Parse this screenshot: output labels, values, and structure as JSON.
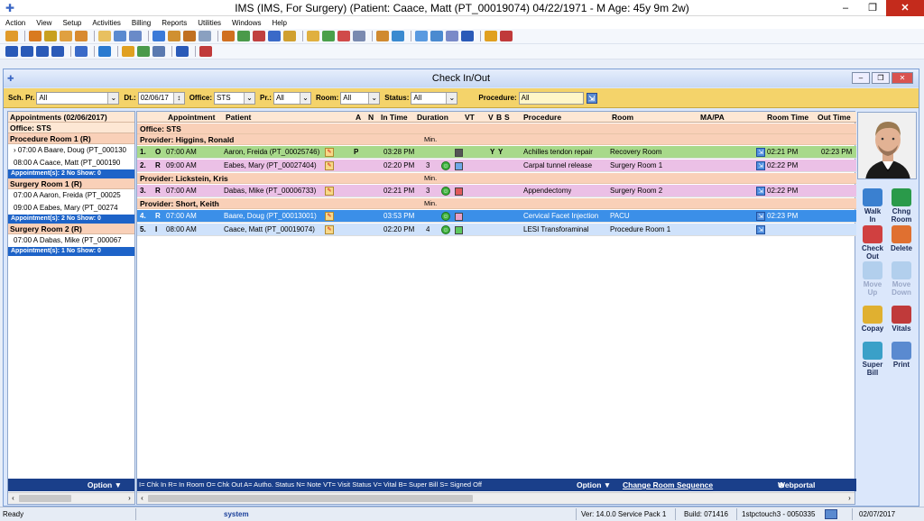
{
  "window": {
    "title": "IMS (IMS, For Surgery)    (Patient: Caace, Matt  (PT_00019074) 04/22/1971 - M Age: 45y 9m 2w)",
    "minimize": "–",
    "restore": "❐",
    "close": "✕"
  },
  "menu": [
    "Action",
    "View",
    "Setup",
    "Activities",
    "Billing",
    "Reports",
    "Utilities",
    "Windows",
    "Help"
  ],
  "toolbar1_colors": [
    "#e09a2a",
    "#d97a20",
    "#c8a020",
    "#e0a040",
    "#d88a30",
    "#e8c060",
    "#5a8ad0",
    "#6a8ac8",
    "#3a7ad8",
    "#d09030",
    "#c07020",
    "#8aa0c0",
    "#d07020",
    "#4a9a4a",
    "#c04040",
    "#3a6ac8",
    "#d0a030",
    "#e0b040",
    "#4aa04a",
    "#d04a4a",
    "#7a8ab0",
    "#d08a30",
    "#3a8ad0",
    "#5a9ae0",
    "#4a8ad0",
    "#7a8ac8",
    "#2a5ab8",
    "#e0a020",
    "#c03a3a"
  ],
  "toolbar2_colors": [
    "#2a5ab8",
    "#2a5ab8",
    "#2a5ab8",
    "#2a5ab8",
    "#3a6ac8",
    "#2a7ad0",
    "#e0a020",
    "#4a9a4a",
    "#5a7ab0",
    "#2a5ab8",
    "#c03a3a"
  ],
  "checkin": {
    "title": "Check In/Out",
    "minimize": "–",
    "restore": "❐",
    "close": "✕",
    "filters": {
      "sch_pr_label": "Sch. Pr.",
      "sch_pr_value": "All",
      "dt_label": "Dt.:",
      "dt_value": "02/06/17",
      "office_label": "Office:",
      "office_value": "STS",
      "pr_label": "Pr.:",
      "pr_value": "All",
      "room_label": "Room:",
      "room_value": "All",
      "status_label": "Status:",
      "status_value": "All",
      "procedure_label": "Procedure:",
      "procedure_value": "All"
    },
    "left": {
      "header": "Appointments (02/06/2017)",
      "office": "Office: STS",
      "groups": [
        {
          "room": "Procedure Room 1 (R)",
          "items": [
            "› 07:00 A   Baare, Doug  (PT_000130",
            "  08:00 A   Caace, Matt  (PT_000190"
          ],
          "summary": "Appointment(s): 2    No Show: 0"
        },
        {
          "room": "Surgery Room 1 (R)",
          "items": [
            "  07:00 A   Aaron, Freida  (PT_00025",
            "  09:00 A   Eabes, Mary  (PT_00274"
          ],
          "summary": "Appointment(s): 2    No Show: 0"
        },
        {
          "room": "Surgery Room 2 (R)",
          "items": [
            "  07:00 A   Dabas, Mike  (PT_000067"
          ],
          "summary": "Appointment(s): 1    No Show: 0"
        }
      ],
      "option_label": "Option ▼"
    },
    "grid": {
      "headers": [
        "Appointment",
        "Patient",
        "A",
        "N",
        "In Time",
        "Duration",
        "VT",
        "V",
        "B",
        "S",
        "Procedure",
        "Room",
        "MA/PA",
        "Room Time",
        "Out Time"
      ],
      "office": "Office: STS",
      "min_label": "Min.",
      "providers": [
        {
          "name": "Provider: Higgins, Ronald",
          "rows": [
            {
              "no": "1.",
              "st": "O",
              "appt": "07:00 AM",
              "patient": "Aaron, Freida  (PT_00025746)",
              "a": "P",
              "in": "03:28 PM",
              "dur": "",
              "v": "Y",
              "b": "Y",
              "proc": "Achilles tendon repair",
              "room": "Recovery Room",
              "room_time": "02:21 PM",
              "out": "02:23 PM",
              "color": "green",
              "face": false,
              "vt_color": "#555555"
            },
            {
              "no": "2.",
              "st": "R",
              "appt": "09:00 AM",
              "patient": "Eabes, Mary  (PT_00027404)",
              "a": "",
              "in": "02:20 PM",
              "dur": "3",
              "v": "",
              "b": "",
              "proc": "Carpal tunnel release",
              "room": "Surgery Room 1",
              "room_time": "02:22 PM",
              "out": "",
              "color": "pink",
              "face": true,
              "vt_color": "#6fa8e8"
            }
          ]
        },
        {
          "name": "Provider: Lickstein, Kris",
          "rows": [
            {
              "no": "3.",
              "st": "R",
              "appt": "07:00 AM",
              "patient": "Dabas, Mike  (PT_00006733)",
              "a": "",
              "in": "02:21 PM",
              "dur": "3",
              "v": "",
              "b": "",
              "proc": "Appendectomy",
              "room": "Surgery Room 2",
              "room_time": "02:22 PM",
              "out": "",
              "color": "pink",
              "face": true,
              "vt_color": "#e05a5a"
            }
          ]
        },
        {
          "name": "Provider: Short, Keith",
          "rows": [
            {
              "no": "4.",
              "st": "R",
              "appt": "07:00 AM",
              "patient": "Baare, Doug  (PT_00013001)",
              "a": "",
              "in": "03:53 PM",
              "dur": "",
              "v": "",
              "b": "",
              "proc": "Cervical Facet Injection",
              "room": "PACU",
              "room_time": "02:23 PM",
              "out": "",
              "color": "sel",
              "face": true,
              "vt_color": "#e8a0c8"
            },
            {
              "no": "5.",
              "st": "I",
              "appt": "08:00 AM",
              "patient": "Caace, Matt  (PT_00019074)",
              "a": "",
              "in": "02:20 PM",
              "dur": "4",
              "v": "",
              "b": "",
              "proc": "LESI Transforaminal",
              "room": "Procedure Room 1",
              "room_time": "",
              "out": "",
              "color": "lb",
              "face": true,
              "vt_color": "#5ec85e"
            }
          ]
        }
      ],
      "legend": "I= Chk In  R= In Room  O= Chk Out  A= Autho. Status  N= Note  VT= Visit Status  V= Vital  B= Super Bill  S= Signed Off",
      "option_label": "Option ▼",
      "change_room": "Change Room Sequence",
      "webportal": "Webportal User"
    },
    "actions": [
      {
        "label": "Walk\nIn",
        "color": "#3a80d0",
        "disabled": false
      },
      {
        "label": "Chng\nRoom",
        "color": "#2a9a4a",
        "disabled": false
      },
      {
        "label": "Check\nOut",
        "color": "#d04040",
        "disabled": false
      },
      {
        "label": "Delete",
        "color": "#e07030",
        "disabled": false
      },
      {
        "label": "Move\nUp",
        "color": "#8ab8e0",
        "disabled": true
      },
      {
        "label": "Move\nDown",
        "color": "#8ab8e0",
        "disabled": true
      },
      {
        "label": "Copay",
        "color": "#e0b030",
        "disabled": false
      },
      {
        "label": "Vitals",
        "color": "#c03a3a",
        "disabled": false
      },
      {
        "label": "Super\nBill",
        "color": "#3aa0c8",
        "disabled": false
      },
      {
        "label": "Print",
        "color": "#5a8ad0",
        "disabled": false
      }
    ]
  },
  "statusbar": {
    "ready": "Ready",
    "user": "system",
    "version": "Ver: 14.0.0 Service Pack 1",
    "build": "Build: 071416",
    "station": "1stpctouch3 - 0050335",
    "date": "02/07/2017"
  }
}
